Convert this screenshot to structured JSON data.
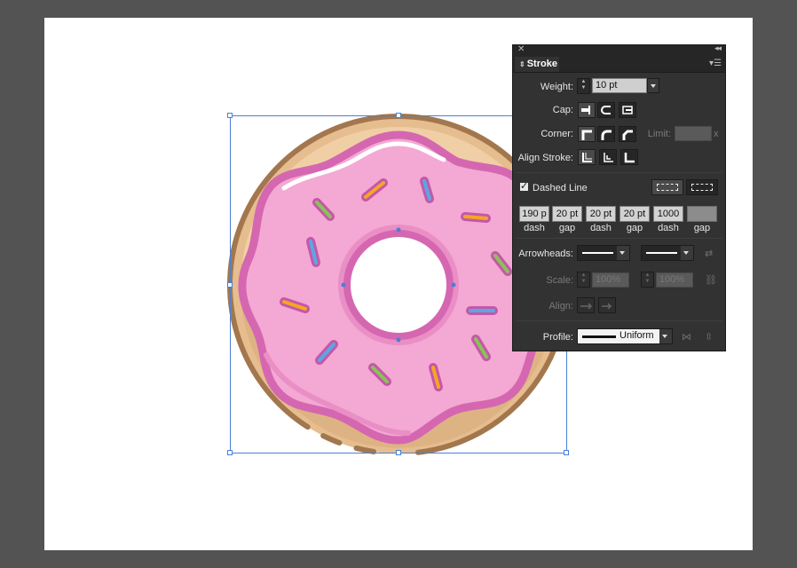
{
  "panel": {
    "tab_label": "Stroke",
    "weight": {
      "label": "Weight:",
      "value": "10 pt"
    },
    "cap": {
      "label": "Cap:"
    },
    "corner": {
      "label": "Corner:",
      "limit_label": "Limit:",
      "limit_suffix": "x"
    },
    "align_stroke": {
      "label": "Align Stroke:"
    },
    "dashed_line": {
      "label": "Dashed Line",
      "checked": true,
      "fields": [
        {
          "value": "190 p",
          "label": "dash"
        },
        {
          "value": "20 pt",
          "label": "gap"
        },
        {
          "value": "20 pt",
          "label": "dash"
        },
        {
          "value": "20 pt",
          "label": "gap"
        },
        {
          "value": "1000",
          "label": "dash"
        },
        {
          "value": "",
          "label": "gap"
        }
      ]
    },
    "arrowheads": {
      "label": "Arrowheads:"
    },
    "scale": {
      "label": "Scale:",
      "start": "100%",
      "end": "100%"
    },
    "align": {
      "label": "Align:"
    },
    "profile": {
      "label": "Profile:",
      "value": "Uniform"
    }
  },
  "colors": {
    "workspace": "#535353",
    "artboard": "#ffffff",
    "selection": "#4a7fd8",
    "dough_outline": "#a3774d",
    "dough": "#e6bd8f",
    "icing": "#f4a8d4",
    "icing_outline": "#d567b1",
    "panel_bg": "#323232"
  },
  "icons": [
    "close-icon",
    "collapse-icon",
    "panel-menu-icon",
    "swap-arrowheads-icon",
    "link-scale-icon",
    "flip-profile-icon"
  ]
}
